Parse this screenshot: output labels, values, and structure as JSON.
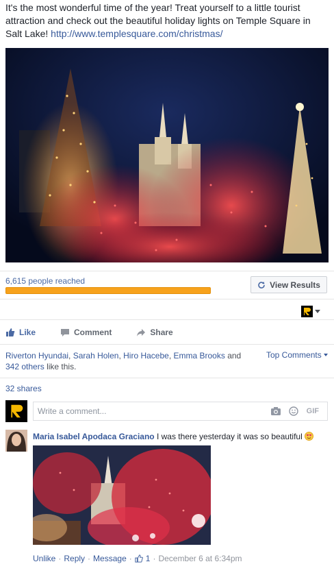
{
  "post": {
    "text": "It's the most wonderful time of the year! Treat yourself to a little tourist attraction and check out the beautiful holiday lights on Temple Square in Salt Lake!",
    "link": "http://www.templesquare.com/christmas/"
  },
  "insights": {
    "reach_text": "6,615 people reached",
    "reach_fraction": 1.0,
    "view_results_label": "View Results"
  },
  "actions": {
    "like": "Like",
    "comment": "Comment",
    "share": "Share"
  },
  "likes": {
    "names": [
      "Riverton Hyundai",
      "Sarah Holen",
      "Hiro Hacebe",
      "Emma Brooks"
    ],
    "and": "and",
    "others_link": "342 others",
    "suffix": "like this.",
    "top_comments": "Top Comments"
  },
  "shares": "32 shares",
  "composer": {
    "placeholder": "Write a comment...",
    "gif_label": "GIF"
  },
  "comment": {
    "author": "Maria Isabel Apodaca Graciano",
    "text": "I was there yesterday it was so beautiful",
    "unlike": "Unlike",
    "reply": "Reply",
    "message": "Message",
    "like_count": "1",
    "timestamp": "December 6 at 6:34pm",
    "sep": "·"
  },
  "colors": {
    "link": "#365899",
    "progress": "#f7a21c"
  },
  "icons": [
    "like-thumb-icon",
    "comment-bubble-icon",
    "share-arrow-icon",
    "refresh-icon",
    "camera-icon",
    "smiley-icon"
  ]
}
